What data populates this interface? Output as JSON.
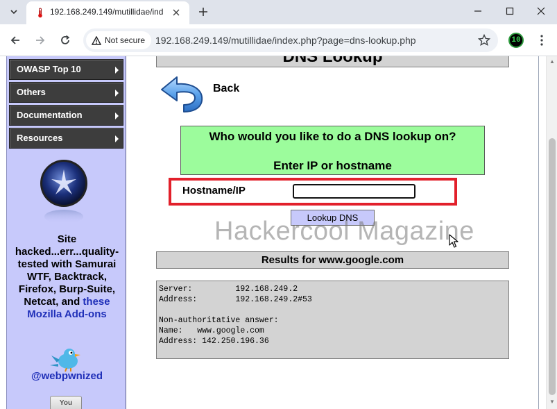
{
  "browser": {
    "tab_title": "192.168.249.149/mutillidae/ind",
    "security_label": "Not secure",
    "url": "192.168.249.149/mutillidae/index.php?page=dns-lookup.php",
    "extension_badge": "10"
  },
  "sidebar": {
    "menu_items": [
      {
        "label": "OWASP Top 10"
      },
      {
        "label": "Others"
      },
      {
        "label": "Documentation"
      },
      {
        "label": "Resources"
      }
    ],
    "blurb_before_link": "Site hacked...err...quality-tested with Samurai WTF, Backtrack, Firefox, Burp-Suite, Netcat, and",
    "blurb_link": "these Mozilla Add-ons",
    "twitter_handle": "@webpwnized",
    "bottom_icon_text": "You"
  },
  "main": {
    "page_title": "DNS Lookup",
    "back_label": "Back",
    "prompt_line1": "Who would you like to do a DNS lookup on?",
    "prompt_line2": "Enter IP or hostname",
    "hostname_label": "Hostname/IP",
    "hostname_value": "",
    "lookup_button": "Lookup DNS",
    "watermark": "Hackercool Magazine",
    "results_title": "Results for www.google.com",
    "results_lines": [
      "Server:         192.168.249.2",
      "Address:        192.168.249.2#53",
      "",
      "Non-authoritative answer:",
      "Name:   www.google.com",
      "Address: 142.250.196.36"
    ]
  },
  "colors": {
    "sidebar_bg": "#c7c9fb",
    "menu_bg": "#3d3d3d",
    "prompt_bg": "#9cfc9c",
    "highlight": "#e2202b",
    "link": "#1f2fb8"
  }
}
